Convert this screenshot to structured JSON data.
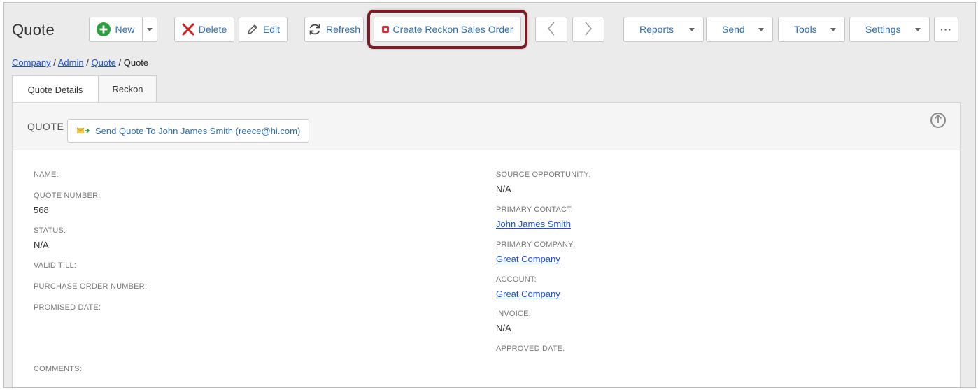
{
  "page": {
    "title": "Quote"
  },
  "toolbar": {
    "new_label": "New",
    "delete_label": "Delete",
    "edit_label": "Edit",
    "refresh_label": "Refresh",
    "create_reckon_label": "Create Reckon Sales Order",
    "reports_label": "Reports",
    "send_label": "Send",
    "tools_label": "Tools",
    "settings_label": "Settings",
    "more_label": "···"
  },
  "breadcrumb": {
    "company": "Company",
    "admin": "Admin",
    "quote_link": "Quote",
    "current": "Quote",
    "sep": " / "
  },
  "tabs": [
    {
      "label": "Quote Details"
    },
    {
      "label": "Reckon"
    }
  ],
  "panel": {
    "title": "QUOTE",
    "send_quote_label": "Send Quote To John James Smith (reece@hi.com)"
  },
  "fields": {
    "name_label": "NAME:",
    "quote_number_label": "QUOTE NUMBER:",
    "quote_number_value": "568",
    "status_label": "STATUS:",
    "status_value": "N/A",
    "valid_till_label": "VALID TILL:",
    "po_number_label": "PURCHASE ORDER NUMBER:",
    "promised_date_label": "PROMISED DATE:",
    "comments_label": "COMMENTS:",
    "source_opportunity_label": "SOURCE OPPORTUNITY:",
    "source_opportunity_value": "N/A",
    "primary_contact_label": "PRIMARY CONTACT:",
    "primary_contact_value": "John James Smith",
    "primary_company_label": "PRIMARY COMPANY:",
    "primary_company_value": "Great Company",
    "account_label": "ACCOUNT:",
    "account_value": "Great Company",
    "invoice_label": "INVOICE:",
    "invoice_value": "N/A",
    "approved_date_label": "APPROVED DATE:"
  },
  "colors": {
    "link": "#1a4fd6",
    "button_text": "#2f6fb5",
    "new_icon": "#2e9e3f",
    "delete_icon": "#d21f1f",
    "reckon_icon": "#d32f3a",
    "highlight_border": "#7a1b25"
  }
}
